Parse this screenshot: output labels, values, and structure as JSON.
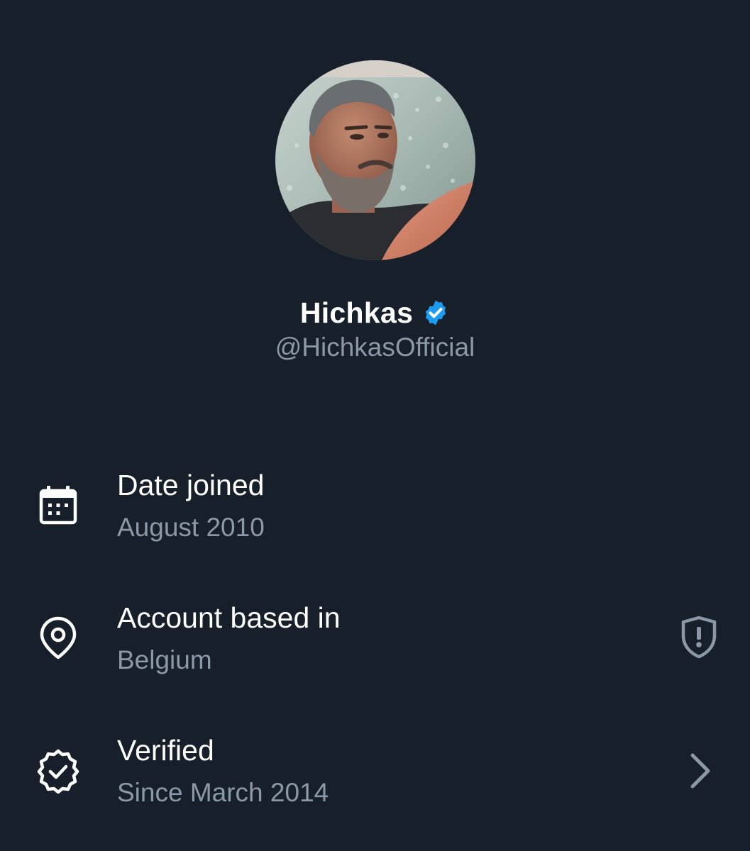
{
  "profile": {
    "display_name": "Hichkas",
    "handle": "@HichkasOfficial",
    "verified_badge_color": "#1d9bf0"
  },
  "info": {
    "joined": {
      "icon": "calendar-icon",
      "title": "Date joined",
      "value": "August 2010"
    },
    "location": {
      "icon": "location-pin-icon",
      "title": "Account based in",
      "value": "Belgium",
      "trailing_icon": "shield-alert-icon"
    },
    "verified": {
      "icon": "verified-badge-icon",
      "title": "Verified",
      "value": "Since March 2014",
      "trailing_icon": "chevron-right-icon"
    }
  },
  "colors": {
    "background": "#17202a",
    "primary_text": "#ffffff",
    "secondary_text": "#8b98a5",
    "accent": "#1d9bf0"
  }
}
